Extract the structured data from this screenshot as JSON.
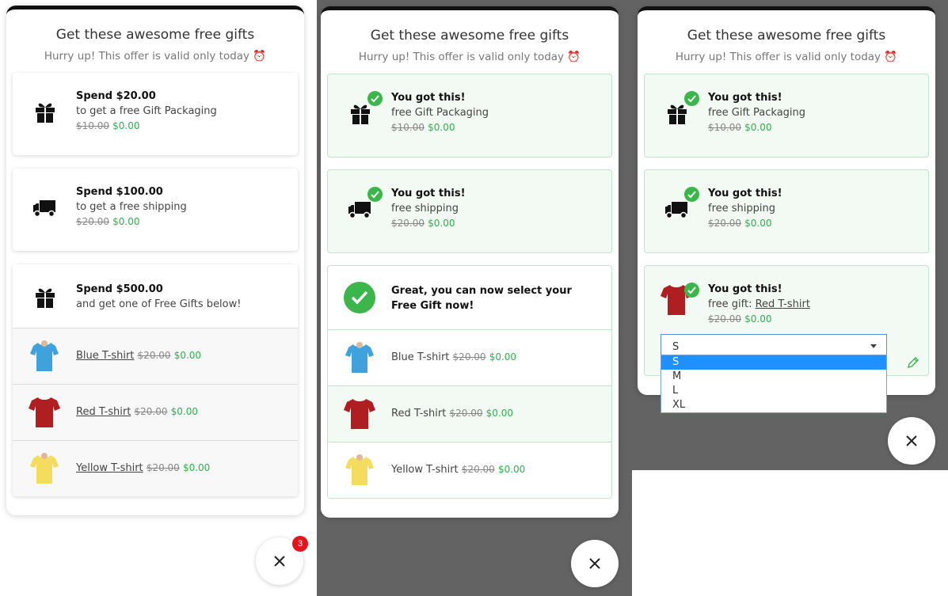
{
  "header": {
    "title": "Get these awesome free gifts",
    "subtitle": "Hurry up! This offer is valid only today ⏰"
  },
  "panel1": {
    "tiers": [
      {
        "heading": "Spend $20.00",
        "desc": "to get a free Gift Packaging",
        "old": "$10.00",
        "new": "$0.00",
        "icon": "gift-icon"
      },
      {
        "heading": "Spend $100.00",
        "desc": "to get a free shipping",
        "old": "$20.00",
        "new": "$0.00",
        "icon": "truck-icon"
      },
      {
        "heading": "Spend $500.00",
        "desc": "and get one of Free Gifts below!",
        "icon": "gift-icon"
      }
    ],
    "gifts": [
      {
        "name": "Blue T-shirt",
        "old": "$20.00",
        "new": "$0.00",
        "color": "#3fa2dc"
      },
      {
        "name": "Red T-shirt",
        "old": "$20.00",
        "new": "$0.00",
        "color": "#b01e22"
      },
      {
        "name": "Yellow T-shirt",
        "old": "$20.00",
        "new": "$0.00",
        "color": "#f3dc5e"
      }
    ],
    "badge": "3"
  },
  "panel2": {
    "tiers": [
      {
        "heading": "You got this!",
        "desc": "free Gift Packaging",
        "old": "$10.00",
        "new": "$0.00"
      },
      {
        "heading": "You got this!",
        "desc": "free shipping",
        "old": "$20.00",
        "new": "$0.00"
      }
    ],
    "select_message": "Great, you can now select your Free Gift now!",
    "gifts": [
      {
        "name": "Blue T-shirt",
        "old": "$20.00",
        "new": "$0.00"
      },
      {
        "name": "Red T-shirt",
        "old": "$20.00",
        "new": "$0.00"
      },
      {
        "name": "Yellow T-shirt",
        "old": "$20.00",
        "new": "$0.00"
      }
    ]
  },
  "panel3": {
    "tiers": [
      {
        "heading": "You got this!",
        "desc": "free Gift Packaging",
        "old": "$10.00",
        "new": "$0.00"
      },
      {
        "heading": "You got this!",
        "desc": "free shipping",
        "old": "$20.00",
        "new": "$0.00"
      },
      {
        "heading": "You got this!",
        "desc_prefix": "free gift: ",
        "desc_link": "Red T-shirt",
        "old": "$20.00",
        "new": "$0.00"
      }
    ],
    "size_select": {
      "value": "S",
      "options": [
        "S",
        "M",
        "L",
        "XL"
      ],
      "active": "S"
    }
  },
  "colors": {
    "accent_green": "#2bb24c",
    "check_green": "#3cb54a",
    "badge_red": "#e8121c",
    "overlay": "#636363"
  }
}
